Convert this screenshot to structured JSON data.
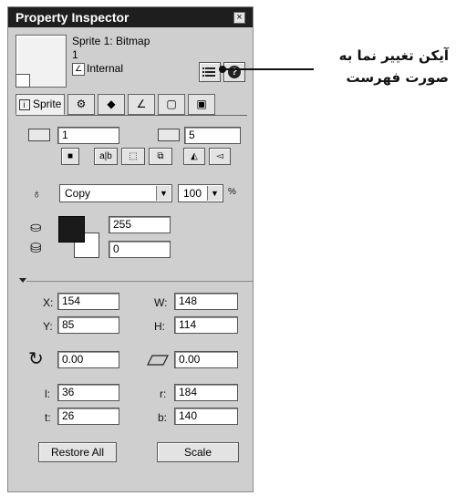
{
  "panel": {
    "title": "Property Inspector",
    "close_glyph": "×"
  },
  "sprite": {
    "name": "Sprite 1: Bitmap",
    "number": "1",
    "cast_type": "Internal"
  },
  "tabs": [
    {
      "label": "Sprite",
      "icon": "info-icon",
      "glyph": "i"
    },
    {
      "label": "",
      "icon": "behavior-gear-icon",
      "glyph": "⚙"
    },
    {
      "label": "",
      "icon": "member-icon",
      "glyph": "◆"
    },
    {
      "label": "",
      "icon": "bitmap-brush-icon",
      "glyph": "∠"
    },
    {
      "label": "",
      "icon": "cast-icon",
      "glyph": "▢"
    },
    {
      "label": "",
      "icon": "movie-icon",
      "glyph": "▣"
    }
  ],
  "frames": {
    "start": "1",
    "end": "5"
  },
  "flags": [
    {
      "name": "lock-button",
      "glyph": "🔒"
    },
    {
      "name": "editable-button",
      "glyph": "a|b"
    },
    {
      "name": "moveable-button",
      "glyph": "⬚"
    },
    {
      "name": "trails-button",
      "glyph": "⧉"
    },
    {
      "name": "flip-horizontal-button",
      "glyph": "◭"
    },
    {
      "name": "flip-vertical-button",
      "glyph": "◅"
    }
  ],
  "ink": {
    "value": "Copy",
    "blend": "100",
    "blend_unit": "%"
  },
  "colors": {
    "fore_value": "255",
    "back_value": "0",
    "fore_swatch": "#1a1a1a",
    "back_swatch": "#ffffff"
  },
  "geometry": {
    "x_label": "X:",
    "x": "154",
    "w_label": "W:",
    "w": "148",
    "y_label": "Y:",
    "y": "85",
    "h_label": "H:",
    "h": "114",
    "rotation": "0.00",
    "skew": "0.00",
    "l_label": "l:",
    "l": "36",
    "r_label": "r:",
    "r": "184",
    "t_label": "t:",
    "t": "26",
    "b_label": "b:",
    "b": "140"
  },
  "buttons": {
    "restore_all": "Restore All",
    "scale": "Scale"
  },
  "annotation": {
    "line1": "آیکن تغییر نما به",
    "line2": "صورت فهرست"
  }
}
